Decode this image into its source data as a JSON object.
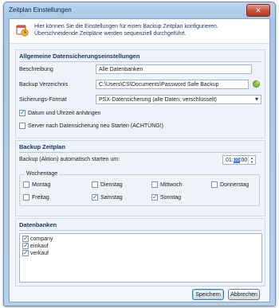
{
  "window": {
    "title": "Zeitplan Einstellungen",
    "close_glyph": "✕"
  },
  "info": {
    "icon": "calendar-clock-icon",
    "text": "Hier können Sie die Einstellungen für einen Backup Zeitplan konfigurieren. Überschneidende Zeitpläne werden sequenziell durchgeführt."
  },
  "general": {
    "title": "Allgemeine Datensicherungseinstellungen",
    "description_label": "Beschreibung",
    "description_value": "Alle Datenbanken",
    "dir_label": "Backup Verzeichnis",
    "dir_value": "C:\\Users\\CS\\Documents\\Password Safe Backup",
    "format_label": "Sicherungs-Format",
    "format_value": "PSX-Datensicherung (alle Daten; verschlüsselt)",
    "checkbox_date_label": "Datum und Uhrzeit anhängen",
    "checkbox_date_checked": true,
    "checkbox_restart_label": "Server nach Datensicherung neu Starten (ACHTUNG!)",
    "checkbox_restart_checked": false
  },
  "schedule": {
    "title": "Backup Zeitplan",
    "start_label": "Backup (Aktion) automatisch starten um:",
    "time_hours": "01:",
    "time_minutes": "00",
    "time_rest": ":00",
    "weekdays_label": "Wochentage",
    "days": [
      {
        "label": "Montag",
        "checked": false
      },
      {
        "label": "Dienstag",
        "checked": false
      },
      {
        "label": "Mittwoch",
        "checked": false
      },
      {
        "label": "Donnerstag",
        "checked": false
      },
      {
        "label": "Freitag",
        "checked": false
      },
      {
        "label": "Samstag",
        "checked": true
      },
      {
        "label": "Sonntag",
        "checked": true
      }
    ]
  },
  "databases": {
    "title": "Datenbanken",
    "items": [
      {
        "label": "company",
        "checked": true
      },
      {
        "label": "einkauf",
        "checked": true
      },
      {
        "label": "verkauf",
        "checked": true
      }
    ]
  },
  "buttons": {
    "save": "Speichern",
    "cancel": "Abbrechen"
  },
  "colors": {
    "accent": "#18346a",
    "selection": "#3b78d6"
  }
}
